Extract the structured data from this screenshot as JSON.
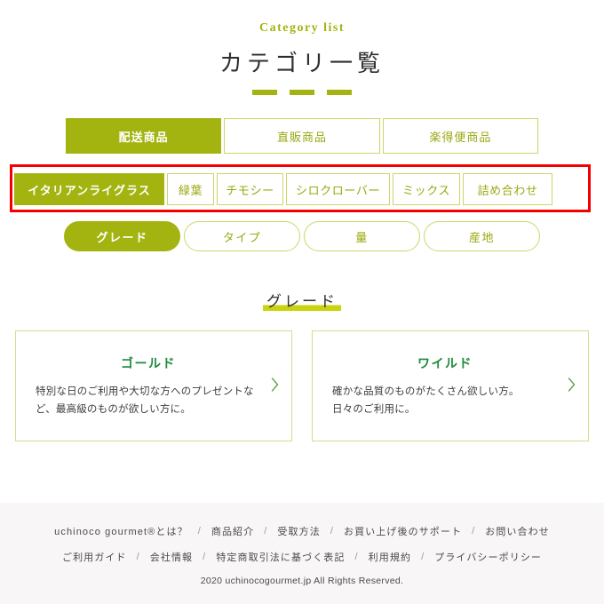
{
  "header": {
    "eyebrow": "Category list",
    "title": "カテゴリ一覧",
    "dash_count": 3
  },
  "tabs_main": [
    {
      "label": "配送商品",
      "active": true
    },
    {
      "label": "直販商品",
      "active": false
    },
    {
      "label": "楽得便商品",
      "active": false
    }
  ],
  "subtabs": [
    {
      "label": "イタリアンライグラス",
      "active": true
    },
    {
      "label": "緑葉",
      "active": false
    },
    {
      "label": "チモシー",
      "active": false
    },
    {
      "label": "シロクローバー",
      "active": false
    },
    {
      "label": "ミックス",
      "active": false
    },
    {
      "label": "詰め合わせ",
      "active": false
    }
  ],
  "pills": [
    {
      "label": "グレード",
      "active": true
    },
    {
      "label": "タイプ",
      "active": false
    },
    {
      "label": "量",
      "active": false
    },
    {
      "label": "産地",
      "active": false
    }
  ],
  "section": {
    "heading": "グレード"
  },
  "cards": [
    {
      "title": "ゴールド",
      "description": "特別な日のご利用や大切な方へのプレゼントなど、最高級のものが欲しい方に。",
      "chevron": "chevron-right-icon"
    },
    {
      "title": "ワイルド",
      "description": "確かな品質のものがたくさん欲しい方。\n日々のご利用に。",
      "chevron": "chevron-right-icon"
    }
  ],
  "footer": {
    "row1": [
      "uchinoco gourmet®とは？",
      "商品紹介",
      "受取方法",
      "お買い上げ後のサポート",
      "お問い合わせ"
    ],
    "row2": [
      "ご利用ガイド",
      "会社情報",
      "特定商取引法に基づく表記",
      "利用規約",
      "プライバシーポリシー"
    ],
    "separator": "/",
    "copyright": "2020 uchinocogourmet.jp All Rights Reserved."
  },
  "annotation": {
    "highlight_color": "#f40000",
    "target": "subtabs-row"
  },
  "colors": {
    "accent": "#a3b411",
    "accent_light": "#cdd66a",
    "highlight_marker": "#c9d40f",
    "card_title": "#1f8a3c",
    "footer_bg": "#f8f6f6",
    "annotation_red": "#f40000"
  }
}
